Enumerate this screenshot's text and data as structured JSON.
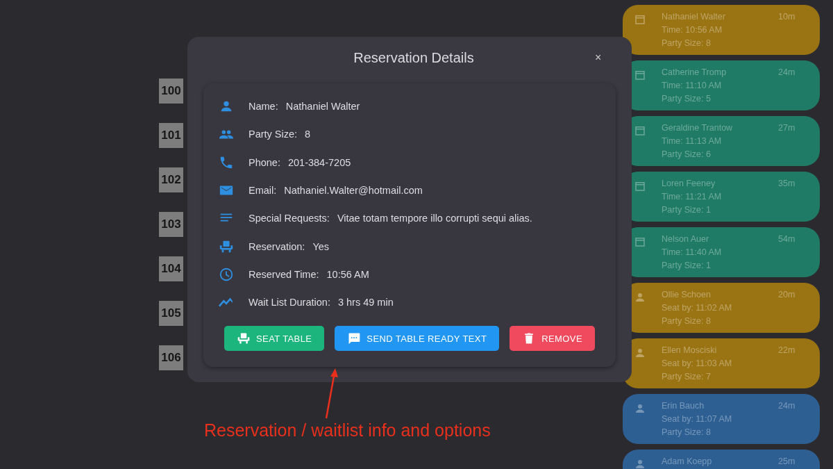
{
  "tables": [
    {
      "label": "100"
    },
    {
      "label": "101"
    },
    {
      "label": "102"
    },
    {
      "label": "103"
    },
    {
      "label": "104"
    },
    {
      "label": "105"
    },
    {
      "label": "106"
    }
  ],
  "dialog": {
    "title": "Reservation Details",
    "close": "×",
    "fields": [
      {
        "kind": "name",
        "label": "Name:",
        "value": "Nathaniel Walter"
      },
      {
        "kind": "party",
        "label": "Party Size:",
        "value": "8"
      },
      {
        "kind": "phone",
        "label": "Phone:",
        "value": "201-384-7205"
      },
      {
        "kind": "email",
        "label": "Email:",
        "value": "Nathaniel.Walter@hotmail.com"
      },
      {
        "kind": "requests",
        "label": "Special Requests:",
        "value": "Vitae totam tempore illo corrupti sequi alias."
      },
      {
        "kind": "reservation",
        "label": "Reservation:",
        "value": "Yes"
      },
      {
        "kind": "time",
        "label": "Reserved Time:",
        "value": "10:56 AM"
      },
      {
        "kind": "duration",
        "label": "Wait List Duration:",
        "value": "3 hrs 49 min"
      }
    ],
    "buttons": [
      {
        "kind": "seat",
        "label": "SEAT TABLE"
      },
      {
        "kind": "text",
        "label": "SEND TABLE READY TEXT"
      },
      {
        "kind": "remove",
        "label": "REMOVE"
      }
    ]
  },
  "queue": [
    {
      "kind": "reservation",
      "color": "#9a7413",
      "name": "Nathaniel Walter",
      "elapsed": "10m",
      "time": "Time: 10:56 AM",
      "party": "Party Size: 8"
    },
    {
      "kind": "reservation",
      "color": "#1f7a66",
      "name": "Catherine Tromp",
      "elapsed": "24m",
      "time": "Time: 11:10 AM",
      "party": "Party Size: 5"
    },
    {
      "kind": "reservation",
      "color": "#1f7a66",
      "name": "Geraldine Trantow",
      "elapsed": "27m",
      "time": "Time: 11:13 AM",
      "party": "Party Size: 6"
    },
    {
      "kind": "reservation",
      "color": "#1f7a66",
      "name": "Loren Feeney",
      "elapsed": "35m",
      "time": "Time: 11:21 AM",
      "party": "Party Size: 1"
    },
    {
      "kind": "reservation",
      "color": "#1f7a66",
      "name": "Nelson Auer",
      "elapsed": "54m",
      "time": "Time: 11:40 AM",
      "party": "Party Size: 1"
    },
    {
      "kind": "waitlist",
      "color": "#9a7413",
      "name": "Ollie Schoen",
      "elapsed": "20m",
      "time": "Seat by: 11:02 AM",
      "party": "Party Size: 8"
    },
    {
      "kind": "waitlist",
      "color": "#9a7413",
      "name": "Ellen Mosciski",
      "elapsed": "22m",
      "time": "Seat by: 11:03 AM",
      "party": "Party Size: 7"
    },
    {
      "kind": "waitlist",
      "color": "#2d5f93",
      "name": "Erin Bauch",
      "elapsed": "24m",
      "time": "Seat by: 11:07 AM",
      "party": "Party Size: 8"
    },
    {
      "kind": "waitlist",
      "color": "#2d5f93",
      "name": "Adam Koepp",
      "elapsed": "25m"
    }
  ],
  "annotation": {
    "text": "Reservation / waitlist info and options"
  }
}
